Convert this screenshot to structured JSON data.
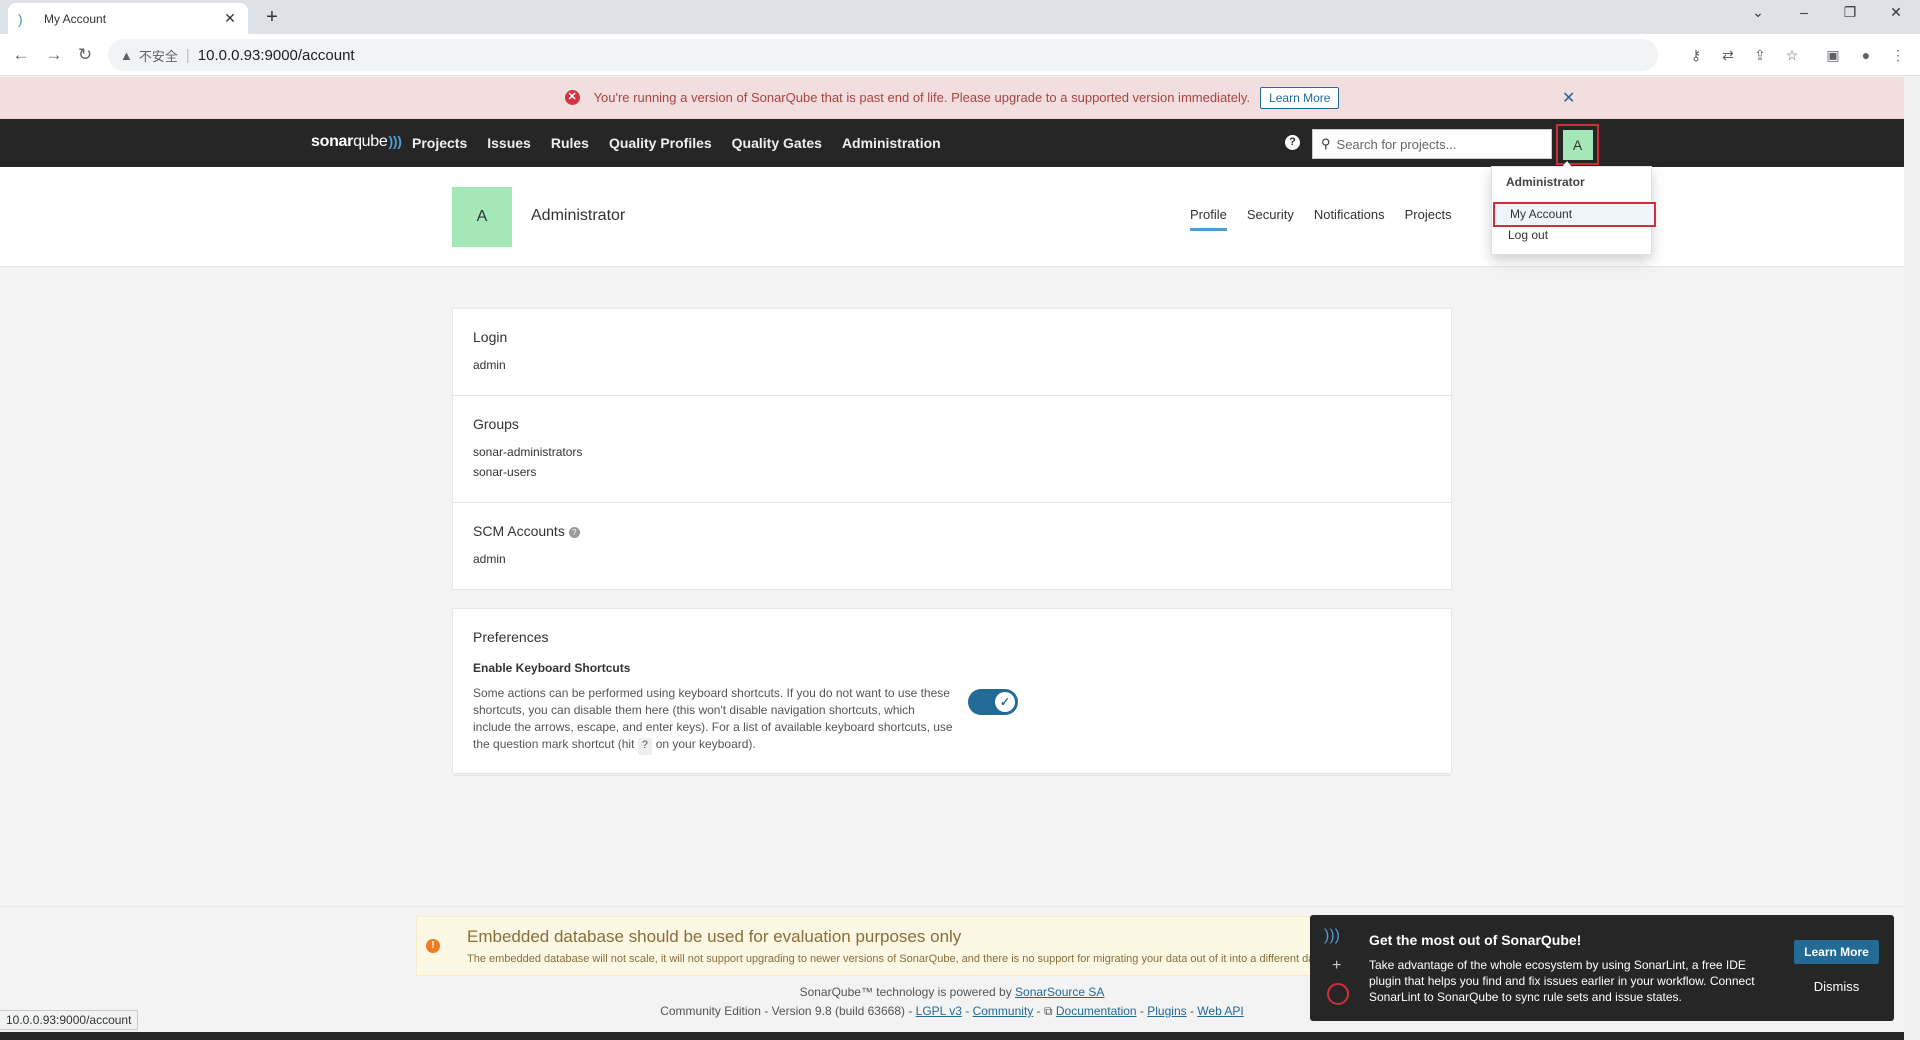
{
  "browser": {
    "tab_title": "My Account",
    "address_insecure": "不安全",
    "address_url": "10.0.0.93:9000/account",
    "status_url": "10.0.0.93:9000/account"
  },
  "eol_banner": {
    "message": "You're running a version of SonarQube that is past end of life. Please upgrade to a supported version immediately.",
    "learn_more": "Learn More"
  },
  "navbar": {
    "logo_bold": "sonar",
    "logo_light": "qube",
    "links": [
      "Projects",
      "Issues",
      "Rules",
      "Quality Profiles",
      "Quality Gates",
      "Administration"
    ],
    "search_placeholder": "Search for projects...",
    "avatar_letter": "A"
  },
  "user_menu": {
    "header": "Administrator",
    "items": [
      "My Account",
      "Log out"
    ]
  },
  "account": {
    "avatar_letter": "A",
    "name": "Administrator",
    "tabs": [
      "Profile",
      "Security",
      "Notifications",
      "Projects"
    ],
    "active_tab": "Profile"
  },
  "profile": {
    "login_label": "Login",
    "login_value": "admin",
    "groups_label": "Groups",
    "groups": [
      "sonar-administrators",
      "sonar-users"
    ],
    "scm_label": "SCM Accounts",
    "scm_value": "admin"
  },
  "preferences": {
    "title": "Preferences",
    "shortcut_label": "Enable Keyboard Shortcuts",
    "desc_before": "Some actions can be performed using keyboard shortcuts. If you do not want to use these shortcuts, you can disable them here (this won't disable navigation shortcuts, which include the arrows, escape, and enter keys). For a list of available keyboard shortcuts, use the question mark shortcut (hit ",
    "desc_key": "?",
    "desc_after": " on your keyboard).",
    "enabled": true
  },
  "db_warning": {
    "title": "Embedded database should be used for evaluation purposes only",
    "description": "The embedded database will not scale, it will not support upgrading to newer versions of SonarQube, and there is no support for migrating your data out of it into a different database engine."
  },
  "footer": {
    "powered_prefix": "SonarQube™ technology is powered by ",
    "powered_link": "SonarSource SA",
    "edition": "Community Edition - Version 9.8 (build 63668) - ",
    "license": "LGPL v3",
    "community": "Community",
    "documentation": "Documentation",
    "plugins": "Plugins",
    "webapi": "Web API"
  },
  "promo": {
    "title": "Get the most out of SonarQube!",
    "body": "Take advantage of the whole ecosystem by using SonarLint, a free IDE plugin that helps you find and fix issues earlier in your workflow. Connect SonarLint to SonarQube to sync rule sets and issue states.",
    "learn_more": "Learn More",
    "dismiss": "Dismiss"
  },
  "colors": {
    "accent": "#236a97",
    "navbar": "#262626",
    "avatar": "#a5e8b8",
    "highlight_box": "#d02f3a"
  }
}
